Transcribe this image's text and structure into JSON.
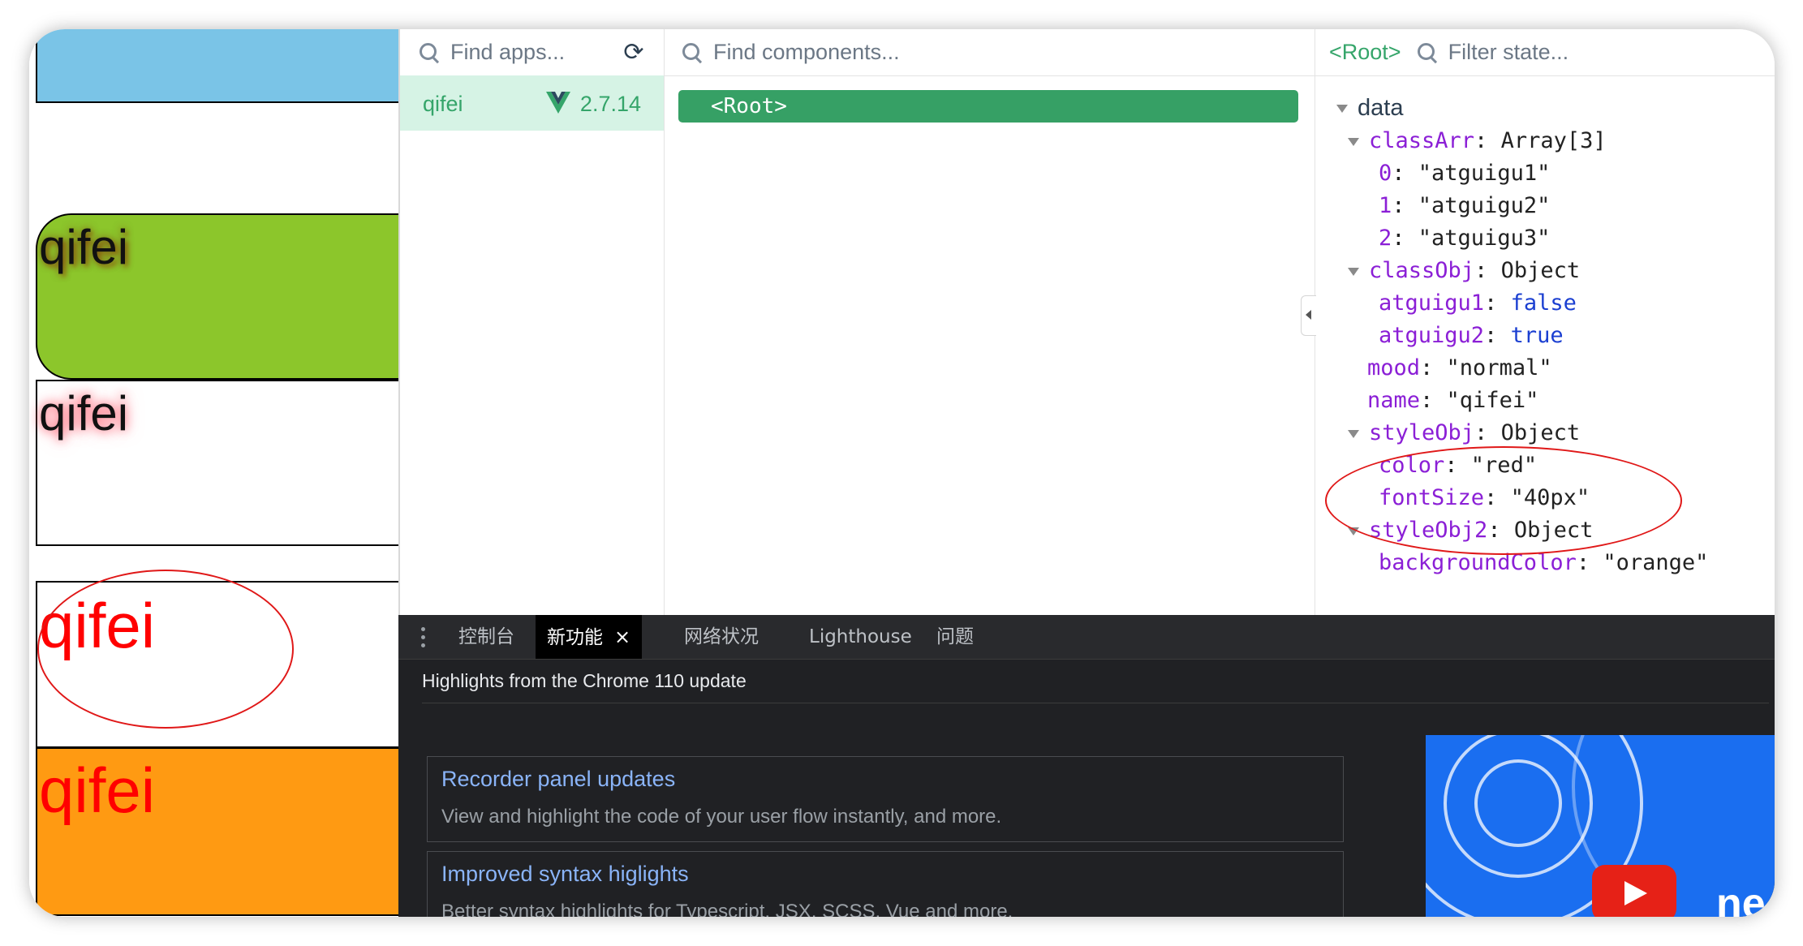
{
  "preview": {
    "box1_text": "qifei",
    "box2_text": "qifei",
    "box3_text": "qifei",
    "box4_text": "qifei"
  },
  "vue_devtools": {
    "apps": {
      "search_placeholder": "Find apps...",
      "app_name": "qifei",
      "vue_version": "2.7.14"
    },
    "components": {
      "search_placeholder": "Find components...",
      "root_node": "<Root>"
    },
    "state": {
      "selected_component": "<Root>",
      "search_placeholder": "Filter state...",
      "section": "data",
      "classArr": {
        "key": "classArr",
        "summary": "Array[3]",
        "items": [
          "\"atguigu1\"",
          "\"atguigu2\"",
          "\"atguigu3\""
        ]
      },
      "classObj": {
        "key": "classObj",
        "summary": "Object",
        "atguigu1_key": "atguigu1",
        "atguigu1_val": "false",
        "atguigu2_key": "atguigu2",
        "atguigu2_val": "true"
      },
      "mood": {
        "key": "mood",
        "val": "\"normal\""
      },
      "name": {
        "key": "name",
        "val": "\"qifei\""
      },
      "styleObj": {
        "key": "styleObj",
        "summary": "Object",
        "color_key": "color",
        "color_val": "\"red\"",
        "fontSize_key": "fontSize",
        "fontSize_val": "\"40px\""
      },
      "styleObj2": {
        "key": "styleObj2",
        "summary": "Object",
        "bg_key": "backgroundColor",
        "bg_val": "\"orange\""
      }
    }
  },
  "chrome_drawer": {
    "tabs": [
      "控制台",
      "新功能",
      "网络状况",
      "Lighthouse",
      "问题"
    ],
    "active_tab": "新功能",
    "close_symbol": "×",
    "whats_new_title": "Highlights from the Chrome 110 update",
    "cards": [
      {
        "title": "Recorder panel updates",
        "desc": "View and highlight the code of your user flow instantly, and more."
      },
      {
        "title": "Improved syntax higlights",
        "desc": "Better syntax highlights for Typescript, JSX, SCSS, Vue and more."
      }
    ],
    "video_text": "ne"
  },
  "colors": {
    "vue_green": "#35a56a",
    "state_key": "#8b1fd6",
    "state_bool": "#1b3fd1",
    "annotation_red": "#e01818",
    "orange_box": "#ff9a12",
    "green_box": "#8cc62b",
    "sky_box": "#7ac4e7"
  },
  "icons": [
    "search-icon",
    "refresh-icon",
    "vue-logo-icon",
    "collapse-arrow-icon",
    "expand-triangle-icon",
    "kebab-menu-icon",
    "close-icon",
    "youtube-play-icon"
  ]
}
